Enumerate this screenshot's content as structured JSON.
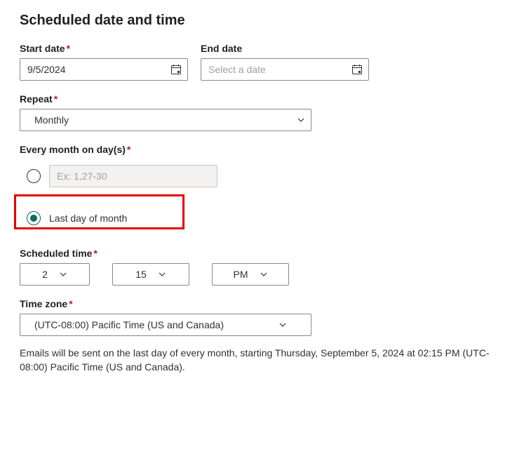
{
  "title": "Scheduled date and time",
  "startDate": {
    "label": "Start date",
    "required": true,
    "value": "9/5/2024"
  },
  "endDate": {
    "label": "End date",
    "required": false,
    "placeholder": "Select a date"
  },
  "repeat": {
    "label": "Repeat",
    "required": true,
    "value": "Monthly"
  },
  "everyMonth": {
    "label": "Every month on day(s)",
    "required": true,
    "daysPlaceholder": "Ex: 1,27-30",
    "lastDayLabel": "Last day of month",
    "selected": "lastDay"
  },
  "scheduledTime": {
    "label": "Scheduled time",
    "required": true,
    "hour": "2",
    "minute": "15",
    "ampm": "PM"
  },
  "timeZone": {
    "label": "Time zone",
    "required": true,
    "value": "(UTC-08:00) Pacific Time (US and Canada)"
  },
  "summary": "Emails will be sent on the last day of every month, starting Thursday, September 5, 2024 at 02:15 PM (UTC-08:00) Pacific Time (US and Canada)."
}
